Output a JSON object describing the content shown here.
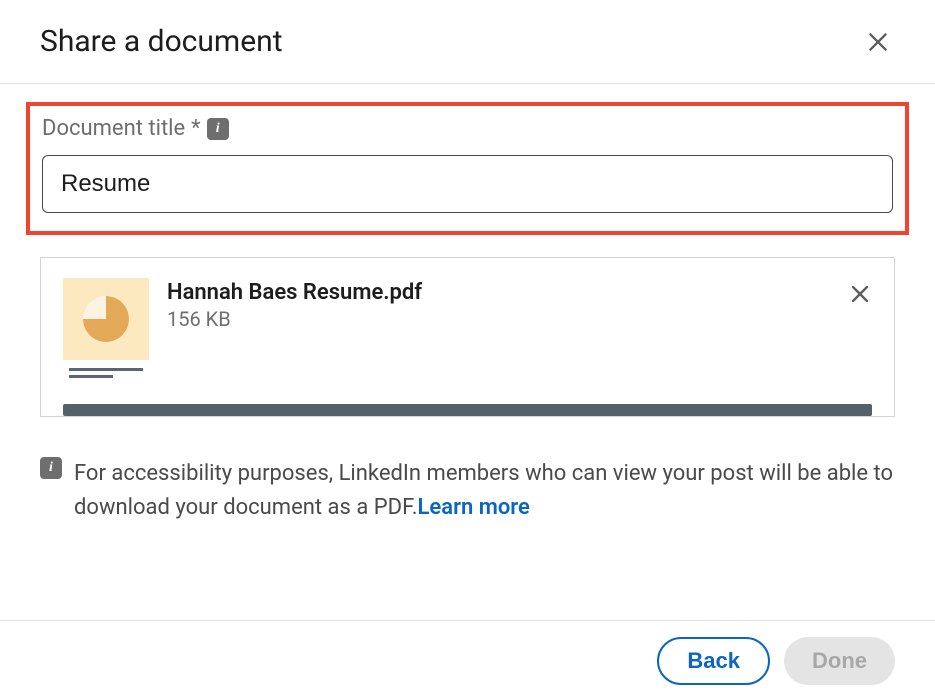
{
  "header": {
    "title": "Share a document"
  },
  "form": {
    "title_label": "Document title",
    "required_mark": "*",
    "title_value": "Resume"
  },
  "file": {
    "name": "Hannah Baes Resume.pdf",
    "size": "156 KB"
  },
  "note": {
    "text": "For accessibility purposes, LinkedIn members who can view your post will be able to download your document as a PDF.",
    "learn_more": "Learn more"
  },
  "footer": {
    "back": "Back",
    "done": "Done"
  },
  "icons": {
    "info": "i"
  }
}
